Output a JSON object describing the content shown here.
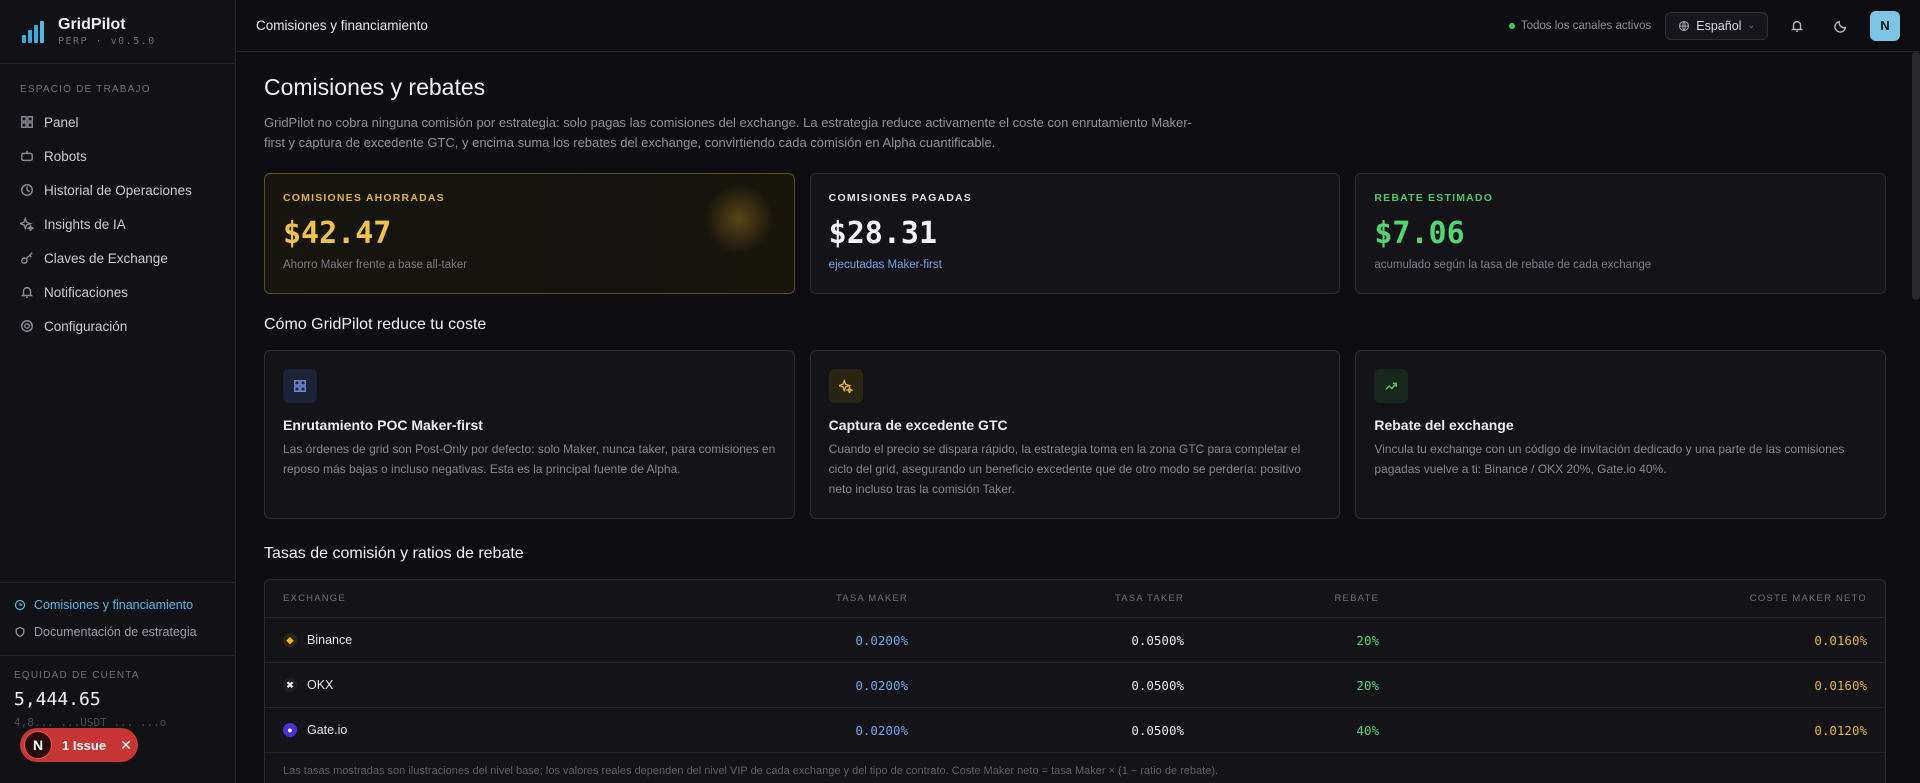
{
  "brand": {
    "name": "GridPilot",
    "sub": "PERP · v0.5.0"
  },
  "sidebar": {
    "section_label": "ESPACIO DE TRABAJO",
    "items": [
      {
        "label": "Panel",
        "icon": "grid-icon"
      },
      {
        "label": "Robots",
        "icon": "bot-icon"
      },
      {
        "label": "Historial de Operaciones",
        "icon": "history-icon"
      },
      {
        "label": "Insights de IA",
        "icon": "sparkle-icon"
      },
      {
        "label": "Claves de Exchange",
        "icon": "key-icon"
      },
      {
        "label": "Notificaciones",
        "icon": "bell-icon"
      },
      {
        "label": "Configuración",
        "icon": "gear-icon"
      }
    ],
    "footer_links": [
      {
        "label": "Comisiones y financiamiento",
        "active": true
      },
      {
        "label": "Documentación de estrategia",
        "active": false
      }
    ],
    "equity": {
      "label": "EQUIDAD DE CUENTA",
      "value": "5,444.65",
      "sub": "4,8... ...USDT ... ...o"
    },
    "issue": {
      "avatar": "N",
      "label": "1 Issue"
    }
  },
  "header": {
    "title": "Comisiones y financiamiento",
    "status": "Todos los canales activos",
    "language": "Español",
    "user_initial": "N"
  },
  "page": {
    "title": "Comisiones y rebates",
    "intro": "GridPilot no cobra ninguna comisión por estrategia: solo pagas las comisiones del exchange. La estrategia reduce activamente el coste con enrutamiento Maker-first y captura de excedente GTC, y encima suma los rebates del exchange, convirtiendo cada comisión en Alpha cuantificable."
  },
  "stats": [
    {
      "key": "COMISIONES AHORRADAS",
      "value": "$42.47",
      "desc": "Ahorro Maker frente a base all-taker",
      "key_color": "#e0b43a",
      "value_color": "#f0c24a",
      "desc_color": "#7a7a85"
    },
    {
      "key": "COMISIONES PAGADAS",
      "value": "$28.31",
      "desc": "ejecutadas Maker-first",
      "key_color": "#e6e6ea",
      "value_color": "#f4f4f7",
      "desc_color": "#6fa6e8"
    },
    {
      "key": "REBATE ESTIMADO",
      "value": "$7.06",
      "desc": "acumulado según la tasa de rebate de cada exchange",
      "key_color": "#4cc96a",
      "value_color": "#52d672",
      "desc_color": "#7a7a85"
    }
  ],
  "how_title": "Cómo GridPilot reduce tu coste",
  "features": [
    {
      "icon": "grid-icon",
      "title": "Enrutamiento POC Maker-first",
      "body": "Las órdenes de grid son Post-Only por defecto: solo Maker, nunca taker, para comisiones en reposo más bajas o incluso negativas. Esta es la principal fuente de Alpha."
    },
    {
      "icon": "sparkle-icon",
      "title": "Captura de excedente GTC",
      "body": "Cuando el precio se dispara rápido, la estrategia toma en la zona GTC para completar el ciclo del grid, asegurando un beneficio excedente que de otro modo se perdería: positivo neto incluso tras la comisión Taker."
    },
    {
      "icon": "trend-up-icon",
      "title": "Rebate del exchange",
      "body": "Vincula tu exchange con un código de invitación dedicado y una parte de las comisiones pagadas vuelve a ti: Binance / OKX 20%, Gate.io 40%."
    }
  ],
  "rates_title": "Tasas de comisión y ratios de rebate",
  "table": {
    "headers": [
      "EXCHANGE",
      "TASA MAKER",
      "TASA TAKER",
      "REBATE",
      "COSTE MAKER NETO"
    ],
    "rows": [
      {
        "exchange": "Binance",
        "maker": "0.0200%",
        "taker": "0.0500%",
        "rebate": "20%",
        "net": "0.0160%"
      },
      {
        "exchange": "OKX",
        "maker": "0.0200%",
        "taker": "0.0500%",
        "rebate": "20%",
        "net": "0.0160%"
      },
      {
        "exchange": "Gate.io",
        "maker": "0.0200%",
        "taker": "0.0500%",
        "rebate": "40%",
        "net": "0.0120%"
      }
    ],
    "note": "Las tasas mostradas son ilustraciones del nivel base; los valores reales dependen del nivel VIP de cada exchange y del tipo de contrato. Coste Maker neto = tasa Maker × (1 − ratio de rebate)."
  },
  "colors": {
    "maker": "#6fa6e8",
    "taker": "#e6e6ea",
    "rebate": "#52d672",
    "net": "#e0b43a"
  }
}
